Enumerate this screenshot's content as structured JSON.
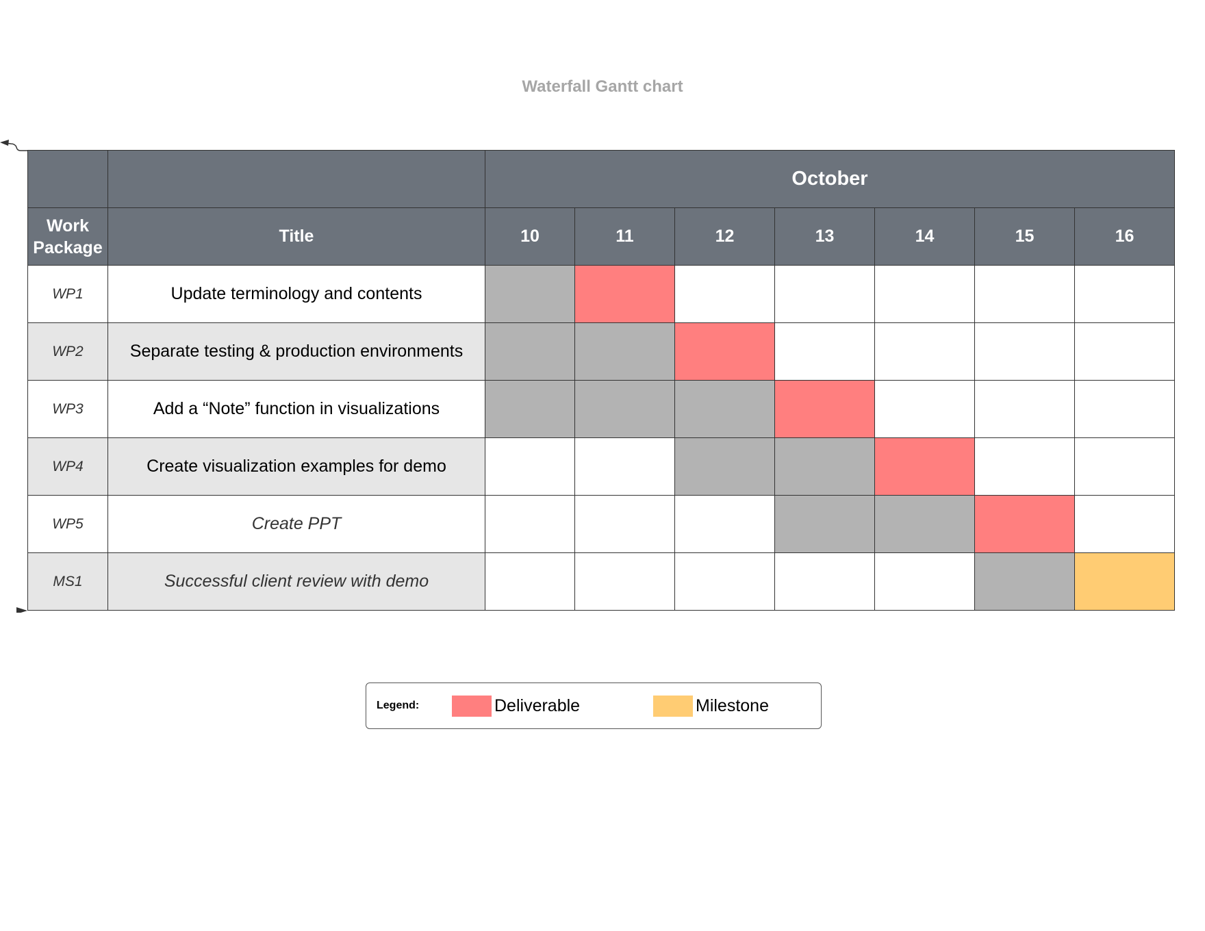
{
  "title": "Waterfall Gantt chart",
  "header": {
    "month": "October",
    "work_package_label": "Work Package",
    "title_label": "Title",
    "days": [
      "10",
      "11",
      "12",
      "13",
      "14",
      "15",
      "16"
    ]
  },
  "rows": [
    {
      "id": "WP1",
      "title": "Update terminology and contents",
      "italic_title": false,
      "cells": [
        "work",
        "deliverable",
        "empty",
        "empty",
        "empty",
        "empty",
        "empty"
      ]
    },
    {
      "id": "WP2",
      "title": "Separate testing & production environments",
      "italic_title": false,
      "cells": [
        "work",
        "work",
        "deliverable",
        "empty",
        "empty",
        "empty",
        "empty"
      ]
    },
    {
      "id": "WP3",
      "title": "Add a “Note” function in visualizations",
      "italic_title": false,
      "cells": [
        "work",
        "work",
        "work",
        "deliverable",
        "empty",
        "empty",
        "empty"
      ]
    },
    {
      "id": "WP4",
      "title": "Create visualization examples for demo",
      "italic_title": false,
      "cells": [
        "empty",
        "empty",
        "work",
        "work",
        "deliverable",
        "empty",
        "empty"
      ]
    },
    {
      "id": "WP5",
      "title": "Create PPT",
      "italic_title": true,
      "cells": [
        "empty",
        "empty",
        "empty",
        "work",
        "work",
        "deliverable",
        "empty"
      ]
    },
    {
      "id": "MS1",
      "title": "Successful client review with demo",
      "italic_title": true,
      "cells": [
        "empty",
        "empty",
        "empty",
        "empty",
        "empty",
        "work",
        "milestone"
      ]
    }
  ],
  "legend": {
    "label": "Legend:",
    "items": [
      {
        "label": "Deliverable",
        "color": "#ff7f7f"
      },
      {
        "label": "Milestone",
        "color": "#ffcc73"
      }
    ]
  },
  "colors": {
    "header": "#6c737c",
    "work": "#b3b3b3",
    "deliverable": "#ff7f7f",
    "milestone": "#ffcc73",
    "alt_row": "#e6e6e6"
  }
}
